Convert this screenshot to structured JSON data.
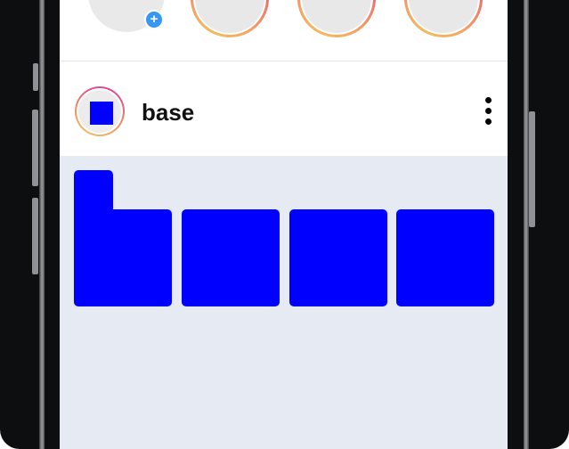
{
  "profile": {
    "username": "base"
  },
  "stories": {
    "add_badge": "+"
  },
  "colors": {
    "accent": "#0000ff",
    "story_ring_start": "#d838a8",
    "story_ring_end": "#f7c85a",
    "badge": "#3897f0",
    "feed_background": "#e6eaf2"
  },
  "icons": {
    "more": "more-vertical-icon",
    "add": "plus-icon"
  }
}
